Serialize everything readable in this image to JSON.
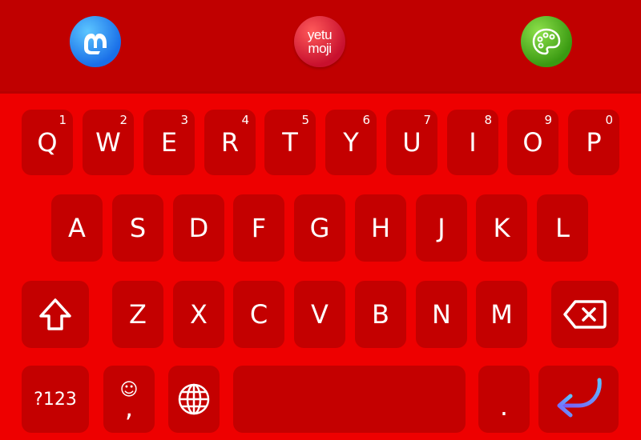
{
  "toolbar": {
    "left_icon": "mastodon-m-icon",
    "center_app": {
      "line1": "yetu",
      "line2": "moji"
    },
    "right_icon": "palette-icon"
  },
  "keyboard": {
    "row1": [
      {
        "letter": "Q",
        "num": "1"
      },
      {
        "letter": "W",
        "num": "2"
      },
      {
        "letter": "E",
        "num": "3"
      },
      {
        "letter": "R",
        "num": "4"
      },
      {
        "letter": "T",
        "num": "5"
      },
      {
        "letter": "Y",
        "num": "6"
      },
      {
        "letter": "U",
        "num": "7"
      },
      {
        "letter": "I",
        "num": "8"
      },
      {
        "letter": "O",
        "num": "9"
      },
      {
        "letter": "P",
        "num": "0"
      }
    ],
    "row2": [
      "A",
      "S",
      "D",
      "F",
      "G",
      "H",
      "J",
      "K",
      "L"
    ],
    "row3": [
      "Z",
      "X",
      "C",
      "V",
      "B",
      "N",
      "M"
    ],
    "row4": {
      "symbols": "?123",
      "emoji": "☺",
      "comma": ",",
      "period": "."
    }
  },
  "colors": {
    "background": "#ee0000",
    "key": "#c40000",
    "topbar": "#c00000",
    "enter_gradient": [
      "#5cc0ff",
      "#7a5af8"
    ]
  }
}
